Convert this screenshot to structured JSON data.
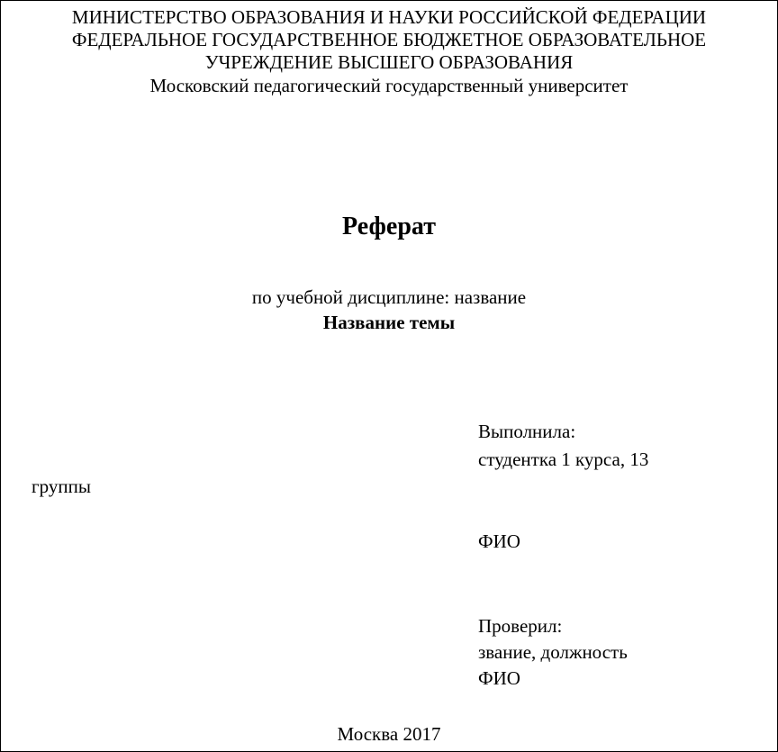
{
  "header": {
    "line1": "МИНИСТЕРСТВО ОБРАЗОВАНИЯ И НАУКИ РОССИЙСКОЙ ФЕДЕРАЦИИ",
    "line2": "ФЕДЕРАЛЬНОЕ ГОСУДАРСТВЕННОЕ БЮДЖЕТНОЕ ОБРАЗОВАТЕЛЬНОЕ",
    "line3": "УЧРЕЖДЕНИЕ ВЫСШЕГО ОБРАЗОВАНИЯ",
    "line4": "Московский педагогический государственный университет"
  },
  "title": "Реферат",
  "discipline_line": "по учебной дисциплине: название",
  "topic": "Название темы",
  "author": {
    "performed_label": "Выполнила:",
    "student_line": "студентка 1 курса, 13",
    "group_word": "группы",
    "fio": "ФИО"
  },
  "reviewer": {
    "checked_label": " Проверил:",
    "rank_line": "звание, должность",
    "fio": "ФИО"
  },
  "footer": "Москва 2017"
}
